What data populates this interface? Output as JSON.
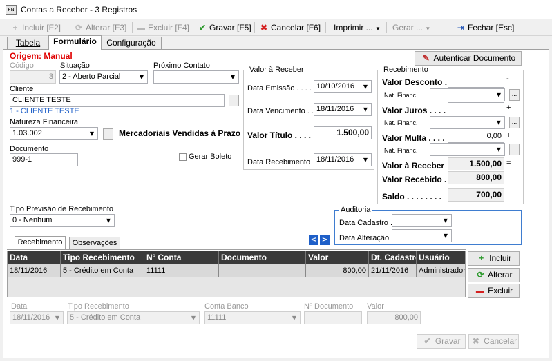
{
  "window": {
    "title": "Contas a Receber - 3 Registros",
    "icon_text": "FN"
  },
  "toolbar": {
    "incluir": "Incluir [F2]",
    "alterar": "Alterar [F3]",
    "excluir": "Excluir [F4]",
    "gravar": "Gravar [F5]",
    "cancelar": "Cancelar [F6]",
    "imprimir": "Imprimir ...",
    "gerar": "Gerar ...",
    "fechar": "Fechar [Esc]"
  },
  "tabs": {
    "tabela": "Tabela",
    "formulario": "Formulário",
    "configuracao": "Configuração"
  },
  "form": {
    "origem": "Origem: Manual",
    "autenticar": "Autenticar Documento",
    "codigo_label": "Código",
    "codigo_value": "3",
    "situacao_label": "Situação",
    "situacao_value": "2 - Aberto Parcial",
    "proximo_contato_label": "Próximo Contato",
    "proximo_contato_value": "",
    "cliente_label": "Cliente",
    "cliente_value": "CLIENTE TESTE",
    "cliente_info": "1 - CLIENTE TESTE",
    "natureza_label": "Natureza Financeira",
    "natureza_value": "1.03.002",
    "natureza_desc": "Mercadoriais Vendidas à Prazo",
    "documento_label": "Documento",
    "documento_value": "999-1",
    "gerar_boleto": "Gerar Boleto",
    "tipo_previsao_label": "Tipo Previsão de Recebimento",
    "tipo_previsao_value": "0 - Nenhum",
    "ellipsis": "..."
  },
  "valor_receber": {
    "title": "Valor à Receber",
    "data_emissao_label": "Data Emissão . . . . .",
    "data_emissao": "10/10/2016",
    "data_vencimento_label": "Data Vencimento . .",
    "data_vencimento": "18/11/2016",
    "valor_titulo_label": "Valor Título . . . .",
    "valor_titulo": "1.500,00",
    "data_recebimento_label": "Data Recebimento",
    "data_recebimento": "18/11/2016"
  },
  "recebimento_box": {
    "title": "Recebimento",
    "valor_desconto_label": "Valor Desconto .",
    "valor_desconto": "",
    "desconto_sign": "-",
    "nat_financ_label": "Nat. Financ.",
    "valor_juros_label": "Valor Juros . . . .",
    "valor_juros": "",
    "juros_sign": "+",
    "valor_multa_label": "Valor Multa . . . .",
    "valor_multa": "0,00",
    "multa_sign": "+",
    "valor_a_receber_label": "Valor à Receber",
    "valor_a_receber": "1.500,00",
    "equals_sign": "=",
    "valor_recebido_label": "Valor Recebido .",
    "valor_recebido": "800,00",
    "saldo_label": "Saldo . . . . . . . .",
    "saldo": "700,00"
  },
  "auditoria": {
    "title": "Auditoria",
    "data_cadastro_label": "Data Cadastro .",
    "data_cadastro": "",
    "data_alteracao_label": "Data Alteração .",
    "data_alteracao": ""
  },
  "subtabs": {
    "recebimento": "Recebimento",
    "observacoes": "Observações"
  },
  "grid": {
    "columns": [
      "Data",
      "Tipo Recebimento",
      "Nº Conta",
      "Documento",
      "Valor",
      "Dt. Cadastro",
      "Usuário"
    ],
    "rows": [
      [
        "18/11/2016",
        "5 - Crédito em Conta",
        "11111",
        "",
        "800,00",
        "21/11/2016",
        "Administrador"
      ]
    ]
  },
  "grid_buttons": {
    "incluir": "Incluir",
    "alterar": "Alterar",
    "excluir": "Excluir"
  },
  "detail": {
    "data_label": "Data",
    "data_value": "18/11/2016",
    "tipo_label": "Tipo Recebimento",
    "tipo_value": "5 - Crédito em Conta",
    "conta_label": "Conta Banco",
    "conta_value": "11111",
    "documento_label": "Nº Documento",
    "documento_value": "",
    "valor_label": "Valor",
    "valor_value": "800,00",
    "gravar": "Gravar",
    "cancelar": "Cancelar"
  },
  "colors": {
    "origem": "#e00000",
    "accent_blue": "#1e5fc8",
    "grid_header": "#3a3a3a"
  }
}
